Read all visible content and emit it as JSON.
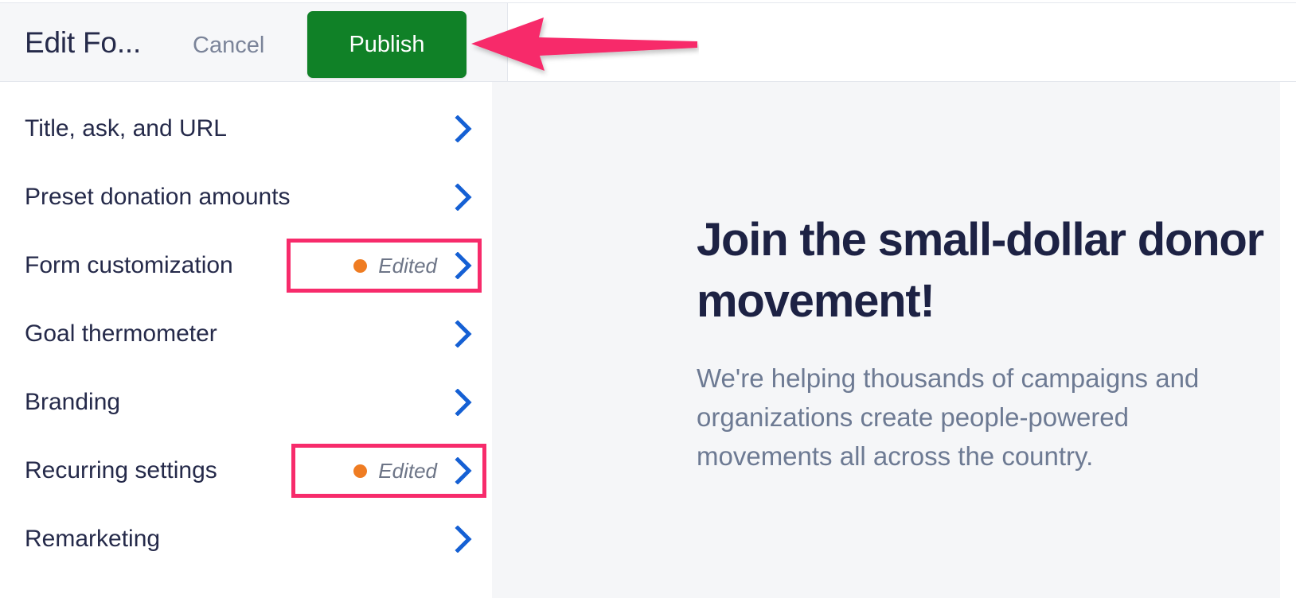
{
  "header": {
    "title": "Edit Fo...",
    "cancel_label": "Cancel",
    "publish_label": "Publish"
  },
  "settings_list": {
    "rows": [
      {
        "label": "Title, ask, and URL",
        "status": "",
        "highlighted": false
      },
      {
        "label": "Preset donation amounts",
        "status": "",
        "highlighted": false
      },
      {
        "label": "Form customization",
        "status": "Edited",
        "highlighted": true
      },
      {
        "label": "Goal thermometer",
        "status": "",
        "highlighted": false
      },
      {
        "label": "Branding",
        "status": "",
        "highlighted": false
      },
      {
        "label": "Recurring settings",
        "status": "Edited",
        "highlighted": true
      },
      {
        "label": "Remarketing",
        "status": "",
        "highlighted": false
      }
    ]
  },
  "preview": {
    "heading": "Join the small-dollar donor movement!",
    "body": "We're helping thousands of campaigns and organizations create people-powered movements all across the country."
  },
  "annotations": {
    "arrow_target": "publish-button",
    "highlight_color": "#f72b6b",
    "arrow_color": "#f72b6b"
  },
  "colors": {
    "publish_green": "#108127",
    "chevron_blue": "#1560d4",
    "edited_dot_orange": "#ef7c22",
    "title_navy": "#252a4a",
    "preview_bg": "#f5f6f8",
    "header_bg": "#f6f7f9"
  },
  "icons": {
    "chevron_right": "chevron-right-icon",
    "edited_dot": "status-dot-icon",
    "callout_arrow": "arrow-left-icon"
  }
}
